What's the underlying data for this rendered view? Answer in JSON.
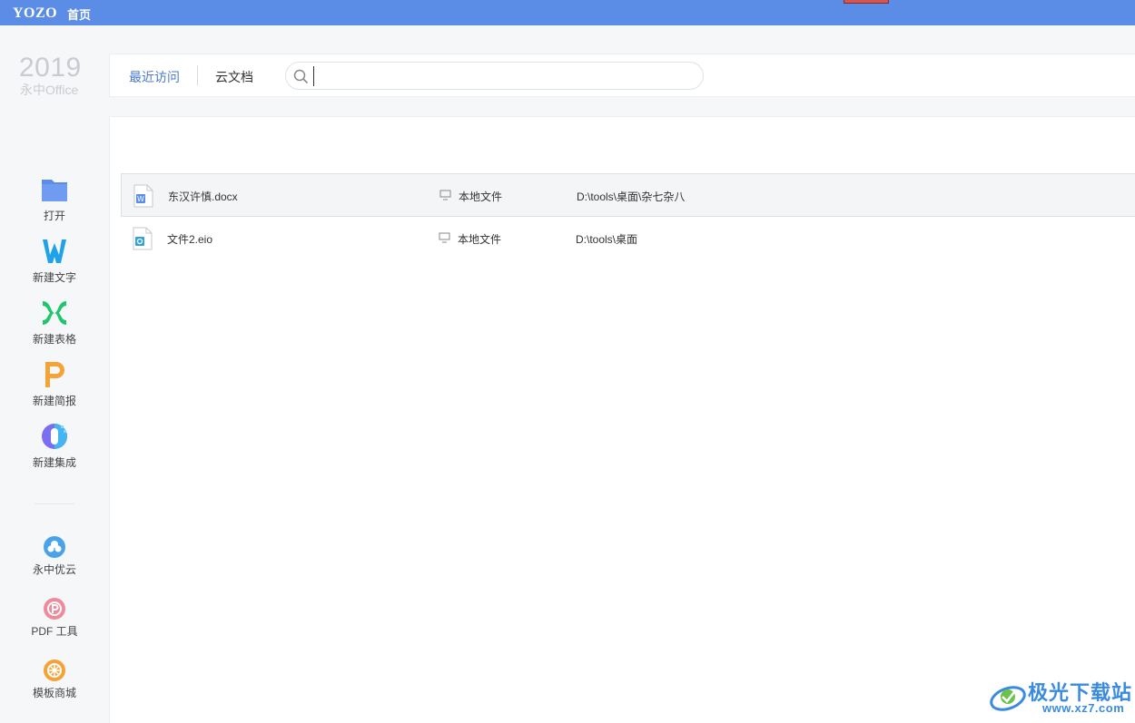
{
  "titlebar": {
    "logo": "YOZO",
    "home_tab": "首页"
  },
  "brand": {
    "year": "2019",
    "name": "永中Office"
  },
  "sidebar": {
    "items": [
      {
        "label": "打开"
      },
      {
        "label": "新建文字"
      },
      {
        "label": "新建表格"
      },
      {
        "label": "新建简报"
      },
      {
        "label": "新建集成"
      }
    ],
    "services": [
      {
        "label": "永中优云"
      },
      {
        "label": "PDF 工具"
      },
      {
        "label": "模板商城"
      }
    ]
  },
  "header": {
    "tab_recent": "最近访问",
    "tab_cloud": "云文档",
    "search_value": ""
  },
  "files": [
    {
      "name": "东汉许慎.docx",
      "location": "本地文件",
      "path": "D:\\tools\\桌面\\杂七杂八",
      "type": "word",
      "selected": true
    },
    {
      "name": "文件2.eio",
      "location": "本地文件",
      "path": "D:\\tools\\桌面",
      "type": "eio",
      "selected": false
    }
  ],
  "watermark": {
    "title": "极光下载站",
    "url": "www.xz7.com"
  },
  "colors": {
    "titlebar": "#5b8de6",
    "accent": "#4a79c7",
    "word_blue": "#1fa2e8",
    "sheet_green": "#1fc66b",
    "ppt_orange": "#f5a236"
  }
}
